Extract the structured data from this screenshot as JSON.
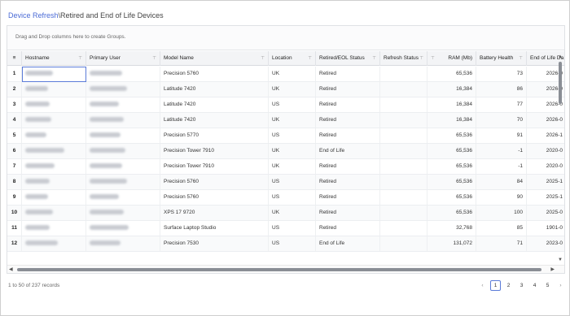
{
  "header": {
    "crumb_link": "Device Refresh",
    "crumb_sep": "\\",
    "crumb_current": "Retired and End of Life Devices"
  },
  "grid": {
    "group_hint": "Drag and Drop columns here to create Groups.",
    "menu_icon": "≡",
    "filter_icon": "⊤",
    "columns": [
      "Hostname",
      "Primary User",
      "Model Name",
      "Location",
      "Retired/EOL Status",
      "Refresh Status",
      "RAM (Mb)",
      "Battery Health",
      "End of Life Da"
    ],
    "rows": [
      {
        "n": "1",
        "model": "Precision 5760",
        "loc": "UK",
        "status": "Retired",
        "ram": "65,536",
        "bat": "73",
        "eol": "2026-0"
      },
      {
        "n": "2",
        "model": "Latitude 7420",
        "loc": "UK",
        "status": "Retired",
        "ram": "16,384",
        "bat": "86",
        "eol": "2026-0"
      },
      {
        "n": "3",
        "model": "Latitude 7420",
        "loc": "US",
        "status": "Retired",
        "ram": "16,384",
        "bat": "77",
        "eol": "2026-0"
      },
      {
        "n": "4",
        "model": "Latitude 7420",
        "loc": "UK",
        "status": "Retired",
        "ram": "16,384",
        "bat": "70",
        "eol": "2026-0"
      },
      {
        "n": "5",
        "model": "Precision 5770",
        "loc": "US",
        "status": "Retired",
        "ram": "65,536",
        "bat": "91",
        "eol": "2026-1"
      },
      {
        "n": "6",
        "model": "Precision Tower 7910",
        "loc": "UK",
        "status": "End of Life",
        "ram": "65,536",
        "bat": "-1",
        "eol": "2020-0"
      },
      {
        "n": "7",
        "model": "Precision Tower 7910",
        "loc": "UK",
        "status": "Retired",
        "ram": "65,536",
        "bat": "-1",
        "eol": "2020-0"
      },
      {
        "n": "8",
        "model": "Precision 5760",
        "loc": "US",
        "status": "Retired",
        "ram": "65,536",
        "bat": "84",
        "eol": "2025-1"
      },
      {
        "n": "9",
        "model": "Precision 5760",
        "loc": "US",
        "status": "Retired",
        "ram": "65,536",
        "bat": "90",
        "eol": "2025-1"
      },
      {
        "n": "10",
        "model": "XPS 17 9720",
        "loc": "UK",
        "status": "Retired",
        "ram": "65,536",
        "bat": "100",
        "eol": "2025-0"
      },
      {
        "n": "11",
        "model": "Surface Laptop Studio",
        "loc": "US",
        "status": "Retired",
        "ram": "32,768",
        "bat": "85",
        "eol": "1901-0"
      },
      {
        "n": "12",
        "model": "Precision 7530",
        "loc": "US",
        "status": "End of Life",
        "ram": "131,072",
        "bat": "71",
        "eol": "2023-0"
      }
    ]
  },
  "footer": {
    "count": "1 to 50 of 237 records",
    "prev": "‹",
    "next": "›",
    "pages": [
      "1",
      "2",
      "3",
      "4",
      "5"
    ],
    "current_page": "1"
  }
}
